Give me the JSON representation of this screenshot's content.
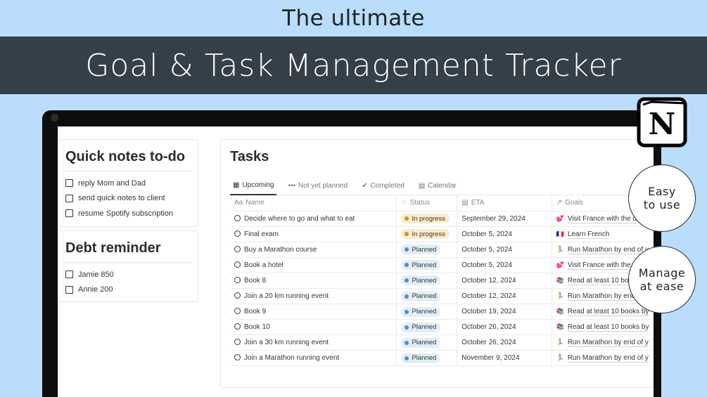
{
  "header": {
    "subtitle": "The ultimate",
    "title": "Goal & Task Management Tracker"
  },
  "quick_notes": {
    "title": "Quick notes to-do",
    "items": [
      "reply Mom and Dad",
      "send quick notes to client",
      "resume Spotify subscription"
    ]
  },
  "debt": {
    "title": "Debt reminder",
    "items": [
      "Jamie 850",
      "Annie 200"
    ]
  },
  "tasks": {
    "title": "Tasks",
    "tabs": [
      "Upcoming",
      "Not yet planned",
      "Completed",
      "Calendar"
    ],
    "columns": [
      "Name",
      "Status",
      "ETA",
      "Goals"
    ],
    "rows": [
      {
        "name": "Decide where to go and what to eat",
        "status": "In progress",
        "eta": "September 29, 2024",
        "goal": "Visit France with the d",
        "goal_icon": "💕"
      },
      {
        "name": "Final exam",
        "status": "In progress",
        "eta": "October 5, 2024",
        "goal": "Learn French",
        "goal_icon": "🇫🇷"
      },
      {
        "name": "Buy a Marathon course",
        "status": "Planned",
        "eta": "October 5, 2024",
        "goal": "Run Marathon by end of y",
        "goal_icon": "🏃"
      },
      {
        "name": "Book a hotel",
        "status": "Planned",
        "eta": "October 5, 2024",
        "goal": "Visit France with the d",
        "goal_icon": "💕"
      },
      {
        "name": "Book 8",
        "status": "Planned",
        "eta": "October 12, 2024",
        "goal": "Read at least 10 boo",
        "goal_icon": "📚"
      },
      {
        "name": "Join a 20 km running event",
        "status": "Planned",
        "eta": "October 12, 2024",
        "goal": "Run Marathon by end",
        "goal_icon": "🏃"
      },
      {
        "name": "Book 9",
        "status": "Planned",
        "eta": "October 19, 2024",
        "goal": "Read at least 10 books by",
        "goal_icon": "📚"
      },
      {
        "name": "Book 10",
        "status": "Planned",
        "eta": "October 26, 2024",
        "goal": "Read at least 10 books by",
        "goal_icon": "📚"
      },
      {
        "name": "Join a 30 km running event",
        "status": "Planned",
        "eta": "October 26, 2024",
        "goal": "Run Marathon by end of y",
        "goal_icon": "🏃"
      },
      {
        "name": "Join a Marathon running event",
        "status": "Planned",
        "eta": "November 9, 2024",
        "goal": "Run Marathon by end of y",
        "goal_icon": "🏃"
      }
    ]
  },
  "status_colors": {
    "In progress": {
      "bg": "#fbeccc",
      "dot": "#cb912f"
    },
    "Planned": {
      "bg": "#e1eef6",
      "dot": "#4d8ec5"
    }
  },
  "badges": {
    "easy": "Easy to use",
    "manage": "Manage at ease"
  },
  "logo": {
    "letter": "N"
  }
}
